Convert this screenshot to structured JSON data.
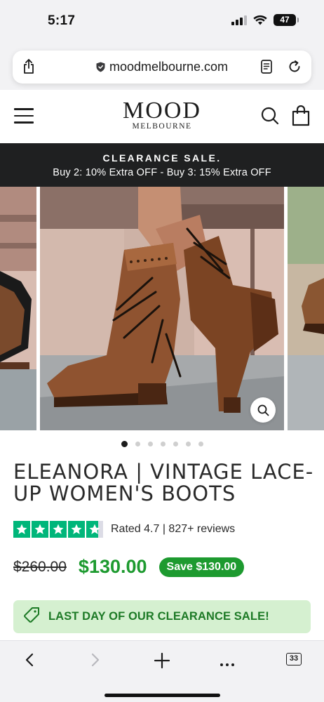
{
  "status_bar": {
    "time": "5:17",
    "battery": "47"
  },
  "browser": {
    "url": "moodmelbourne.com",
    "tab_count": "33"
  },
  "site": {
    "logo_main": "MOOD",
    "logo_sub": "MELBOURNE"
  },
  "announcement": {
    "headline": "CLEARANCE SALE.",
    "detail": "Buy 2: 10% Extra OFF - Buy 3: 15% Extra OFF"
  },
  "gallery": {
    "slide_count": 7,
    "active_index": 0
  },
  "product": {
    "title": "ELEANORA | VINTAGE LACE-UP WOMEN'S BOOTS",
    "rating_value": 4.7,
    "rating_text": "Rated 4.7 | 827+ reviews",
    "old_price": "$260.00",
    "new_price": "$130.00",
    "save_badge": "Save $130.00",
    "banner": "LAST DAY OF OUR CLEARANCE SALE!"
  },
  "colors": {
    "accent_green": "#1d9a2f",
    "star_green": "#00b67a",
    "banner_bg": "#d5f0d0",
    "announce_bg": "#1f2021"
  },
  "icons": {
    "share": "share-icon",
    "lock": "lock-icon",
    "reader": "reader-icon",
    "reload": "reload-icon",
    "menu": "menu-icon",
    "search": "search-icon",
    "bag": "bag-icon",
    "zoom": "zoom-icon",
    "tag": "tag-icon",
    "back": "back-icon",
    "forward": "forward-icon",
    "new_tab": "plus-icon",
    "more": "more-icon",
    "tabs": "tabs-icon"
  }
}
